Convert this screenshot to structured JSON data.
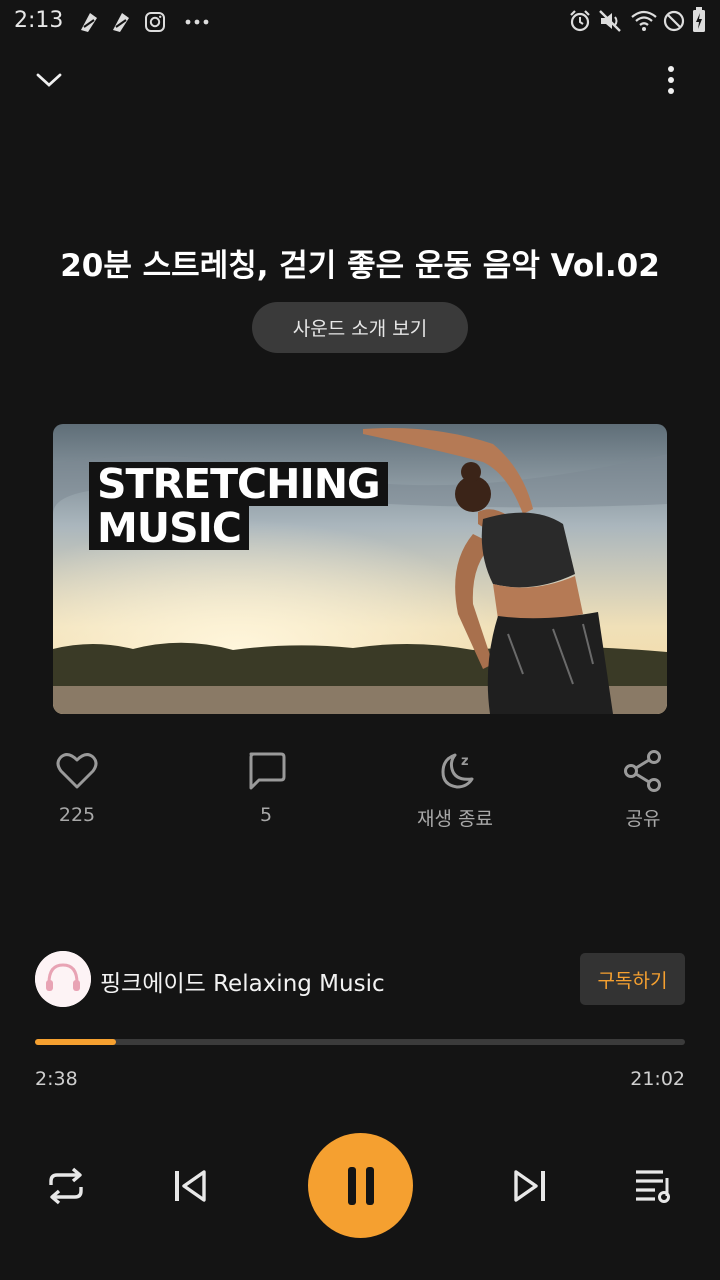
{
  "status_bar": {
    "time": "2:13"
  },
  "player": {
    "title": "20분 스트레칭, 걷기 좋은 운동 음악 Vol.02",
    "intro_button": "사운드 소개 보기",
    "cover_text": [
      "STRETCHING",
      "MUSIC"
    ],
    "actions": {
      "like_count": "225",
      "comment_count": "5",
      "sleep_timer_label": "재생 종료",
      "share_label": "공유"
    },
    "channel": {
      "name": "핑크에이드 Relaxing Music",
      "subscribe_label": "구독하기"
    },
    "progress": {
      "current": "2:38",
      "total": "21:02",
      "fraction": 0.125
    }
  },
  "colors": {
    "accent": "#f5a030",
    "background": "#141414"
  },
  "icons": [
    "collapse-chevron-icon",
    "more-vert-icon",
    "heart-icon",
    "comment-icon",
    "sleep-moon-icon",
    "share-icon",
    "repeat-icon",
    "previous-icon",
    "pause-icon",
    "next-icon",
    "playlist-icon"
  ]
}
